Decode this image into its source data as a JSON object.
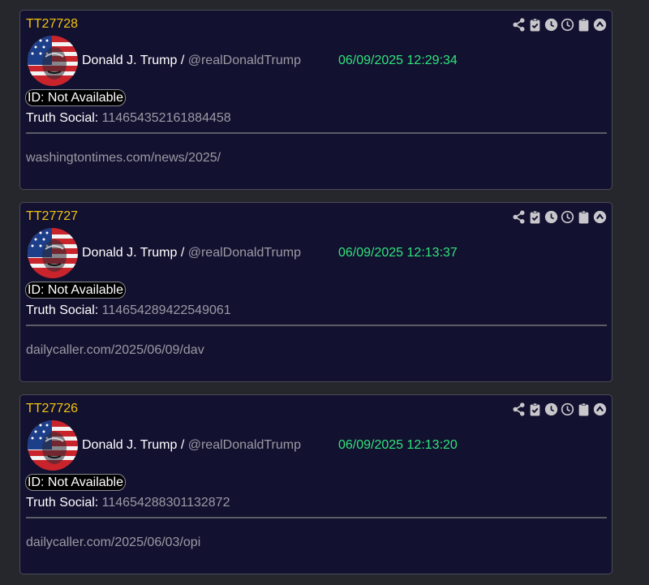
{
  "posts": [
    {
      "code": "TT27728",
      "author": "Donald J. Trump / ",
      "handle": "@realDonaldTrump",
      "timestamp": "06/09/2025 12:29:34",
      "id_label": "ID: Not Available",
      "platform_label": "Truth Social: ",
      "post_number": "114654352161884458",
      "link": "washingtontimes.com/news/2025/"
    },
    {
      "code": "TT27727",
      "author": "Donald J. Trump / ",
      "handle": "@realDonaldTrump",
      "timestamp": "06/09/2025 12:13:37",
      "id_label": "ID: Not Available",
      "platform_label": "Truth Social: ",
      "post_number": "114654289422549061",
      "link": "dailycaller.com/2025/06/09/dav"
    },
    {
      "code": "TT27726",
      "author": "Donald J. Trump / ",
      "handle": "@realDonaldTrump",
      "timestamp": "06/09/2025 12:13:20",
      "id_label": "ID: Not Available",
      "platform_label": "Truth Social: ",
      "post_number": "114654288301132872",
      "link": "dailycaller.com/2025/06/03/opi"
    }
  ],
  "icons": [
    "share-icon",
    "clipboard-check-icon",
    "clock-filled-icon",
    "clock-outline-icon",
    "clipboard-icon",
    "arrow-up-circle-icon"
  ],
  "colors": {
    "background": "#25272d",
    "card": "#131130",
    "code": "#f1c40f",
    "timestamp": "#2fe37b",
    "muted": "#9a9aa4"
  }
}
